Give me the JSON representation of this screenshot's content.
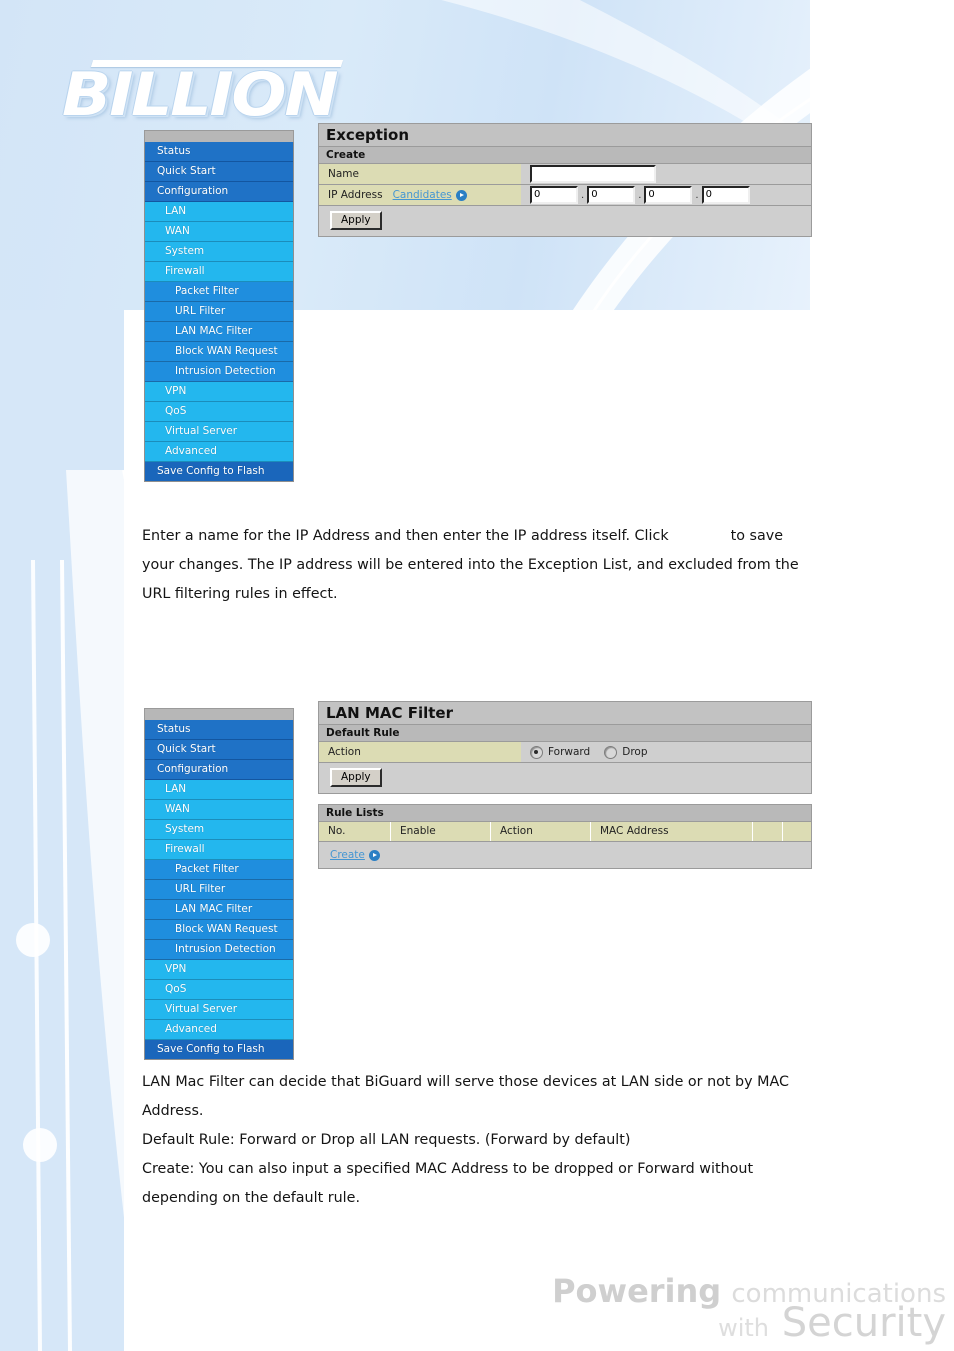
{
  "brand": {
    "logo_text": "BILLION",
    "footer_line1_bold": "Powering",
    "footer_line1_light": "communications",
    "footer_line2_light": "with",
    "footer_line2_bold": "Security"
  },
  "colors": {
    "menu_level0": "#1f72c6",
    "menu_level1": "#23b7ee",
    "menu_level2": "#1f8ede",
    "menu_flash": "#1a66bb",
    "label_cell": "#dcdcb4",
    "panel_body": "#cfcfcf",
    "panel_header": "#c2c2c2",
    "link_blue": "#4596d2",
    "page_band": "#d6e7f8"
  },
  "sidebar": {
    "items": [
      {
        "label": "Status",
        "level": 0
      },
      {
        "label": "Quick Start",
        "level": 0
      },
      {
        "label": "Configuration",
        "level": 0
      },
      {
        "label": "LAN",
        "level": 1
      },
      {
        "label": "WAN",
        "level": 1
      },
      {
        "label": "System",
        "level": 1
      },
      {
        "label": "Firewall",
        "level": 1
      },
      {
        "label": "Packet Filter",
        "level": 2
      },
      {
        "label": "URL Filter",
        "level": 2
      },
      {
        "label": "LAN MAC Filter",
        "level": 2
      },
      {
        "label": "Block WAN Request",
        "level": 2
      },
      {
        "label": "Intrusion Detection",
        "level": 2
      },
      {
        "label": "VPN",
        "level": 1
      },
      {
        "label": "QoS",
        "level": 1
      },
      {
        "label": "Virtual Server",
        "level": 1
      },
      {
        "label": "Advanced",
        "level": 1
      },
      {
        "label": "Save Config to Flash",
        "level": 3
      }
    ]
  },
  "exception_panel": {
    "title": "Exception",
    "section": "Create",
    "name_label": "Name",
    "name_value": "",
    "name_placeholder": "",
    "ip_label": "IP Address",
    "candidates_link": "Candidates",
    "ip_octets": [
      "0",
      "0",
      "0",
      "0"
    ],
    "apply_label": "Apply"
  },
  "lan_mac_panel": {
    "title": "LAN MAC Filter",
    "section_default": "Default Rule",
    "action_label": "Action",
    "options": [
      {
        "label": "Forward",
        "selected": true
      },
      {
        "label": "Drop",
        "selected": false
      }
    ],
    "apply_label": "Apply",
    "section_rules": "Rule Lists",
    "columns": [
      "No.",
      "Enable",
      "Action",
      "MAC Address",
      "",
      ""
    ],
    "rows": [],
    "create_link": "Create"
  },
  "body_text": {
    "para1_before": "Enter a name for the IP Address and then enter the IP address itself. Click",
    "para1_after": "to save your changes. The IP address will be entered into the Exception List, and excluded from the URL filtering rules in effect.",
    "para2_line1": "LAN Mac Filter can decide that BiGuard will serve those devices at LAN side or not by MAC Address.",
    "para2_line2": "Default Rule: Forward or Drop all LAN requests. (Forward by default)",
    "para2_line3": "Create: You can also input a specified MAC Address to be dropped or Forward without depending on the default rule."
  }
}
